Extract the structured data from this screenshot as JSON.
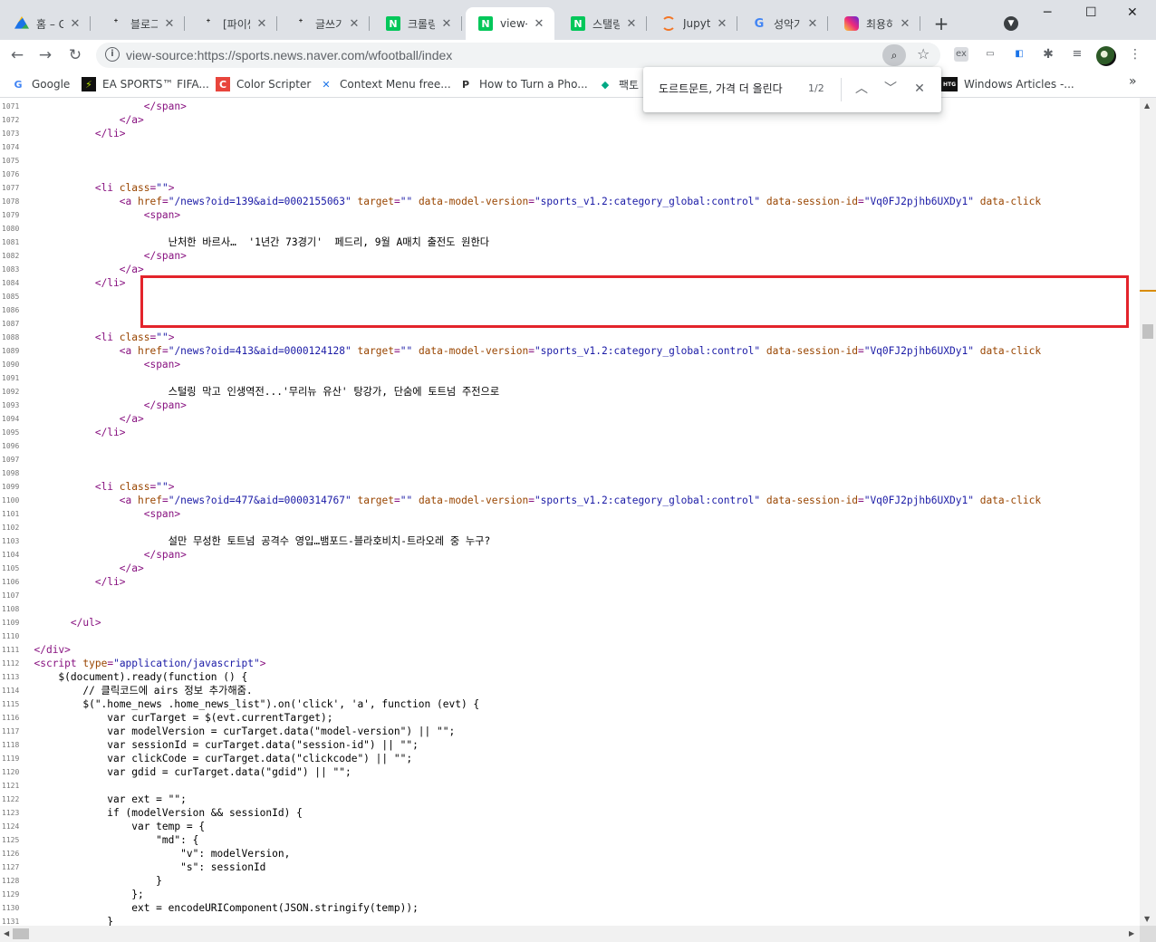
{
  "browser": {
    "tabs": [
      {
        "title": "홈 – Go",
        "icon": "google-drive-icon",
        "active": false
      },
      {
        "title": "블로그",
        "icon": "tistory-icon",
        "active": false
      },
      {
        "title": "[파이썬",
        "icon": "tistory-icon",
        "active": false
      },
      {
        "title": "글쓰기",
        "icon": "tistory-icon",
        "active": false
      },
      {
        "title": "크롤링",
        "icon": "naver-icon",
        "active": false
      },
      {
        "title": "view-s",
        "icon": "naver-icon",
        "active": true
      },
      {
        "title": "스탤링",
        "icon": "naver-icon",
        "active": false
      },
      {
        "title": "Jupyte",
        "icon": "jupyter-icon",
        "active": false
      },
      {
        "title": "성악가",
        "icon": "google-icon",
        "active": false
      },
      {
        "title": "최용하",
        "icon": "instagram-icon",
        "active": false
      }
    ],
    "new_tab": "+",
    "window": {
      "minimize": "─",
      "maximize": "☐",
      "close": "✕"
    },
    "url": "view-source:https://sports.news.naver.com/wfootball/index",
    "bookmarks": [
      {
        "label": "Google",
        "icon": "google-icon"
      },
      {
        "label": "EA SPORTS™ FIFA...",
        "icon": "ea-icon"
      },
      {
        "label": "Color Scripter",
        "icon": "colorscripter-icon"
      },
      {
        "label": "Context Menu free...",
        "icon": "context-menu-icon"
      },
      {
        "label": "How to Turn a Pho...",
        "icon": "p-icon"
      },
      {
        "label": "팩토",
        "icon": "factor-icon"
      },
      {
        "label": "Windows Articles -...",
        "icon": "htg-icon"
      }
    ],
    "bookmarks_more": "»"
  },
  "find": {
    "query": "도르트문트, 가격 더 올린다",
    "count": "1/2"
  },
  "source_lines": [
    {
      "n": "1071",
      "html": "                  <span class=\"txt\"></span><span class=\"tag\">&lt;/span&gt;</span>"
    },
    {
      "n": "1072",
      "html": "              <span class=\"tag\">&lt;/a&gt;</span>"
    },
    {
      "n": "1073",
      "html": "          <span class=\"tag\">&lt;/li&gt;</span>"
    },
    {
      "n": "1074",
      "html": ""
    },
    {
      "n": "1075",
      "html": ""
    },
    {
      "n": "1076",
      "html": ""
    },
    {
      "n": "1077",
      "html": "          <span class=\"tag\">&lt;li </span><span class=\"attr\">class</span><span class=\"tag\">=</span><span class=\"val\">\"\"</span><span class=\"tag\">&gt;</span>"
    },
    {
      "n": "1078",
      "html": "              <span class=\"tag\">&lt;a </span><span class=\"attr\">href</span><span class=\"tag\">=</span><span class=\"val\">\"/news?oid=139&amp;aid=0002155063\"</span> <span class=\"attr\">target</span><span class=\"tag\">=</span><span class=\"val\">\"\"</span> <span class=\"attr\">data-model-version</span><span class=\"tag\">=</span><span class=\"val\">\"sports_v1.2:category_global:control\"</span> <span class=\"attr\">data-session-id</span><span class=\"tag\">=</span><span class=\"val\">\"Vq0FJ2pjhb6UXDy1\"</span> <span class=\"attr\">data-click</span>"
    },
    {
      "n": "1079",
      "html": "                  <span class=\"tag\">&lt;span&gt;</span>"
    },
    {
      "n": "1080",
      "html": ""
    },
    {
      "n": "1081",
      "html": "                      난처한 바르사…  '1년간 73경기'  페드리, 9월 A매치 출전도 원한다"
    },
    {
      "n": "1082",
      "html": "                  <span class=\"tag\">&lt;/span&gt;</span>"
    },
    {
      "n": "1083",
      "html": "              <span class=\"tag\">&lt;/a&gt;</span>"
    },
    {
      "n": "1084",
      "html": "          <span class=\"tag\">&lt;/li&gt;</span>"
    },
    {
      "n": "1085",
      "html": ""
    },
    {
      "n": "1086",
      "html": ""
    },
    {
      "n": "1087",
      "html": ""
    },
    {
      "n": "1088",
      "html": "          <span class=\"tag\">&lt;li </span><span class=\"attr\">class</span><span class=\"tag\">=</span><span class=\"val\">\"\"</span><span class=\"tag\">&gt;</span>"
    },
    {
      "n": "1089",
      "html": "              <span class=\"tag\">&lt;a </span><span class=\"attr\">href</span><span class=\"tag\">=</span><span class=\"val\">\"/news?oid=413&amp;aid=0000124128\"</span> <span class=\"attr\">target</span><span class=\"tag\">=</span><span class=\"val\">\"\"</span> <span class=\"attr\">data-model-version</span><span class=\"tag\">=</span><span class=\"val\">\"sports_v1.2:category_global:control\"</span> <span class=\"attr\">data-session-id</span><span class=\"tag\">=</span><span class=\"val\">\"Vq0FJ2pjhb6UXDy1\"</span> <span class=\"attr\">data-click</span>"
    },
    {
      "n": "1090",
      "html": "                  <span class=\"tag\">&lt;span&gt;</span>"
    },
    {
      "n": "1091",
      "html": ""
    },
    {
      "n": "1092",
      "html": "                      스털링 막고 인생역전...'무리뉴 유산' 탕강가, 단숨에 토트넘 주전으로"
    },
    {
      "n": "1093",
      "html": "                  <span class=\"tag\">&lt;/span&gt;</span>"
    },
    {
      "n": "1094",
      "html": "              <span class=\"tag\">&lt;/a&gt;</span>"
    },
    {
      "n": "1095",
      "html": "          <span class=\"tag\">&lt;/li&gt;</span>"
    },
    {
      "n": "1096",
      "html": ""
    },
    {
      "n": "1097",
      "html": ""
    },
    {
      "n": "1098",
      "html": ""
    },
    {
      "n": "1099",
      "html": "          <span class=\"tag\">&lt;li </span><span class=\"attr\">class</span><span class=\"tag\">=</span><span class=\"val\">\"\"</span><span class=\"tag\">&gt;</span>"
    },
    {
      "n": "1100",
      "html": "              <span class=\"tag\">&lt;a </span><span class=\"attr\">href</span><span class=\"tag\">=</span><span class=\"val\">\"/news?oid=477&amp;aid=0000314767\"</span> <span class=\"attr\">target</span><span class=\"tag\">=</span><span class=\"val\">\"\"</span> <span class=\"attr\">data-model-version</span><span class=\"tag\">=</span><span class=\"val\">\"sports_v1.2:category_global:control\"</span> <span class=\"attr\">data-session-id</span><span class=\"tag\">=</span><span class=\"val\">\"Vq0FJ2pjhb6UXDy1\"</span> <span class=\"attr\">data-click</span>"
    },
    {
      "n": "1101",
      "html": "                  <span class=\"tag\">&lt;span&gt;</span>"
    },
    {
      "n": "1102",
      "html": ""
    },
    {
      "n": "1103",
      "html": "                      설만 무성한 토트넘 공격수 영입…뱀포드-블라호비치-트라오레 중 누구?"
    },
    {
      "n": "1104",
      "html": "                  <span class=\"tag\">&lt;/span&gt;</span>"
    },
    {
      "n": "1105",
      "html": "              <span class=\"tag\">&lt;/a&gt;</span>"
    },
    {
      "n": "1106",
      "html": "          <span class=\"tag\">&lt;/li&gt;</span>"
    },
    {
      "n": "1107",
      "html": ""
    },
    {
      "n": "1108",
      "html": ""
    },
    {
      "n": "1109",
      "html": "      <span class=\"tag\">&lt;/ul&gt;</span>"
    },
    {
      "n": "1110",
      "html": ""
    },
    {
      "n": "1111",
      "html": "<span class=\"tag\">&lt;/div&gt;</span>"
    },
    {
      "n": "1112",
      "html": "<span class=\"tag\">&lt;script </span><span class=\"attr\">type</span><span class=\"tag\">=</span><span class=\"val\">\"application/javascript\"</span><span class=\"tag\">&gt;</span>"
    },
    {
      "n": "1113",
      "html": "    $(document).ready(function () {"
    },
    {
      "n": "1114",
      "html": "        // 클릭코드에 airs 정보 추가해줌."
    },
    {
      "n": "1115",
      "html": "        $(\".home_news .home_news_list\").on('click', 'a', function (evt) {"
    },
    {
      "n": "1116",
      "html": "            var curTarget = $(evt.currentTarget);"
    },
    {
      "n": "1117",
      "html": "            var modelVersion = curTarget.data(\"model-version\") || \"\";"
    },
    {
      "n": "1118",
      "html": "            var sessionId = curTarget.data(\"session-id\") || \"\";"
    },
    {
      "n": "1119",
      "html": "            var clickCode = curTarget.data(\"clickcode\") || \"\";"
    },
    {
      "n": "1120",
      "html": "            var gdid = curTarget.data(\"gdid\") || \"\";"
    },
    {
      "n": "1121",
      "html": ""
    },
    {
      "n": "1122",
      "html": "            var ext = \"\";"
    },
    {
      "n": "1123",
      "html": "            if (modelVersion &amp;&amp; sessionId) {"
    },
    {
      "n": "1124",
      "html": "                var temp = {"
    },
    {
      "n": "1125",
      "html": "                    \"md\": {"
    },
    {
      "n": "1126",
      "html": "                        \"v\": modelVersion,"
    },
    {
      "n": "1127",
      "html": "                        \"s\": sessionId"
    },
    {
      "n": "1128",
      "html": "                    }"
    },
    {
      "n": "1129",
      "html": "                };"
    },
    {
      "n": "1130",
      "html": "                ext = encodeURIComponent(JSON.stringify(temp));"
    },
    {
      "n": "1131",
      "html": "            }"
    }
  ],
  "colors": {
    "highlight_box": "#e3242b",
    "tag": "#881280",
    "attr": "#994500",
    "value": "#1a1aa6"
  }
}
